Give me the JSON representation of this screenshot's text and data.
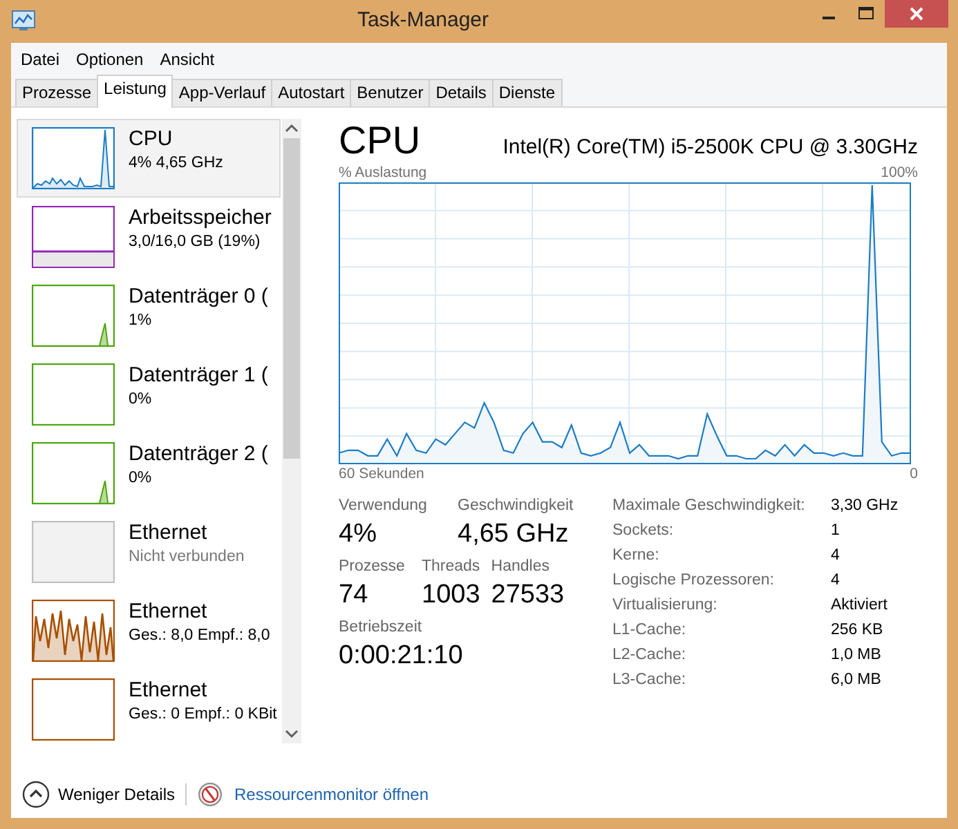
{
  "window": {
    "title": "Task-Manager"
  },
  "menu": [
    "Datei",
    "Optionen",
    "Ansicht"
  ],
  "tabs": [
    {
      "label": "Prozesse",
      "selected": false
    },
    {
      "label": "Leistung",
      "selected": true
    },
    {
      "label": "App-Verlauf",
      "selected": false
    },
    {
      "label": "Autostart",
      "selected": false
    },
    {
      "label": "Benutzer",
      "selected": false
    },
    {
      "label": "Details",
      "selected": false
    },
    {
      "label": "Dienste",
      "selected": false
    }
  ],
  "sidebar": {
    "items": [
      {
        "name": "CPU",
        "detail": "4% 4,65 GHz",
        "kind": "cpu",
        "color": "#1c7cc4",
        "selected": true
      },
      {
        "name": "Arbeitsspeicher",
        "detail": "3,0/16,0 GB (19%)",
        "kind": "memory",
        "color": "#9528b4",
        "selected": false
      },
      {
        "name": "Datenträger 0 (",
        "detail": "1%",
        "kind": "spike",
        "color": "#4da60c",
        "selected": false
      },
      {
        "name": "Datenträger 1 (",
        "detail": "0%",
        "kind": "flat",
        "color": "#4da60c",
        "selected": false
      },
      {
        "name": "Datenträger 2 (",
        "detail": "0%",
        "kind": "spike",
        "color": "#4da60c",
        "selected": false
      },
      {
        "name": "Ethernet",
        "detail": "Nicht verbunden",
        "kind": "none",
        "color": "#c0c0c0",
        "selected": false
      },
      {
        "name": "Ethernet",
        "detail": "Ges.: 8,0 Empf.: 8,0",
        "kind": "busy",
        "color": "#a74f01",
        "selected": false
      },
      {
        "name": "Ethernet",
        "detail": "Ges.: 0 Empf.: 0 KBit",
        "kind": "flat",
        "color": "#a74f01",
        "selected": false
      }
    ]
  },
  "panel": {
    "title": "CPU",
    "subtitle": "Intel(R) Core(TM) i5-2500K CPU @ 3.30GHz",
    "graph_label": "% Auslastung",
    "graph_max": "100%",
    "graph_start": "60 Sekunden",
    "graph_end": "0",
    "stat_rows": [
      [
        {
          "label": "Verwendung",
          "value": "4%"
        },
        {
          "label": "Geschwindigkeit",
          "value": "4,65 GHz"
        }
      ],
      [
        {
          "label": "Prozesse",
          "value": "74"
        },
        {
          "label": "Threads",
          "value": "1003"
        },
        {
          "label": "Handles",
          "value": "27533"
        }
      ],
      [
        {
          "label": "Betriebszeit",
          "value": "0:00:21:10"
        }
      ]
    ],
    "details": [
      {
        "label": "Maximale Geschwindigkeit:",
        "value": "3,30 GHz"
      },
      {
        "label": "Sockets:",
        "value": "1"
      },
      {
        "label": "Kerne:",
        "value": "4"
      },
      {
        "label": "Logische Prozessoren:",
        "value": "4"
      },
      {
        "label": "Virtualisierung:",
        "value": "Aktiviert"
      },
      {
        "label": "L1-Cache:",
        "value": "256 KB"
      },
      {
        "label": "L2-Cache:",
        "value": "1,0 MB"
      },
      {
        "label": "L3-Cache:",
        "value": "6,0 MB"
      }
    ]
  },
  "footer": {
    "toggle": "Weniger Details",
    "link": "Ressourcenmonitor öffnen"
  }
}
